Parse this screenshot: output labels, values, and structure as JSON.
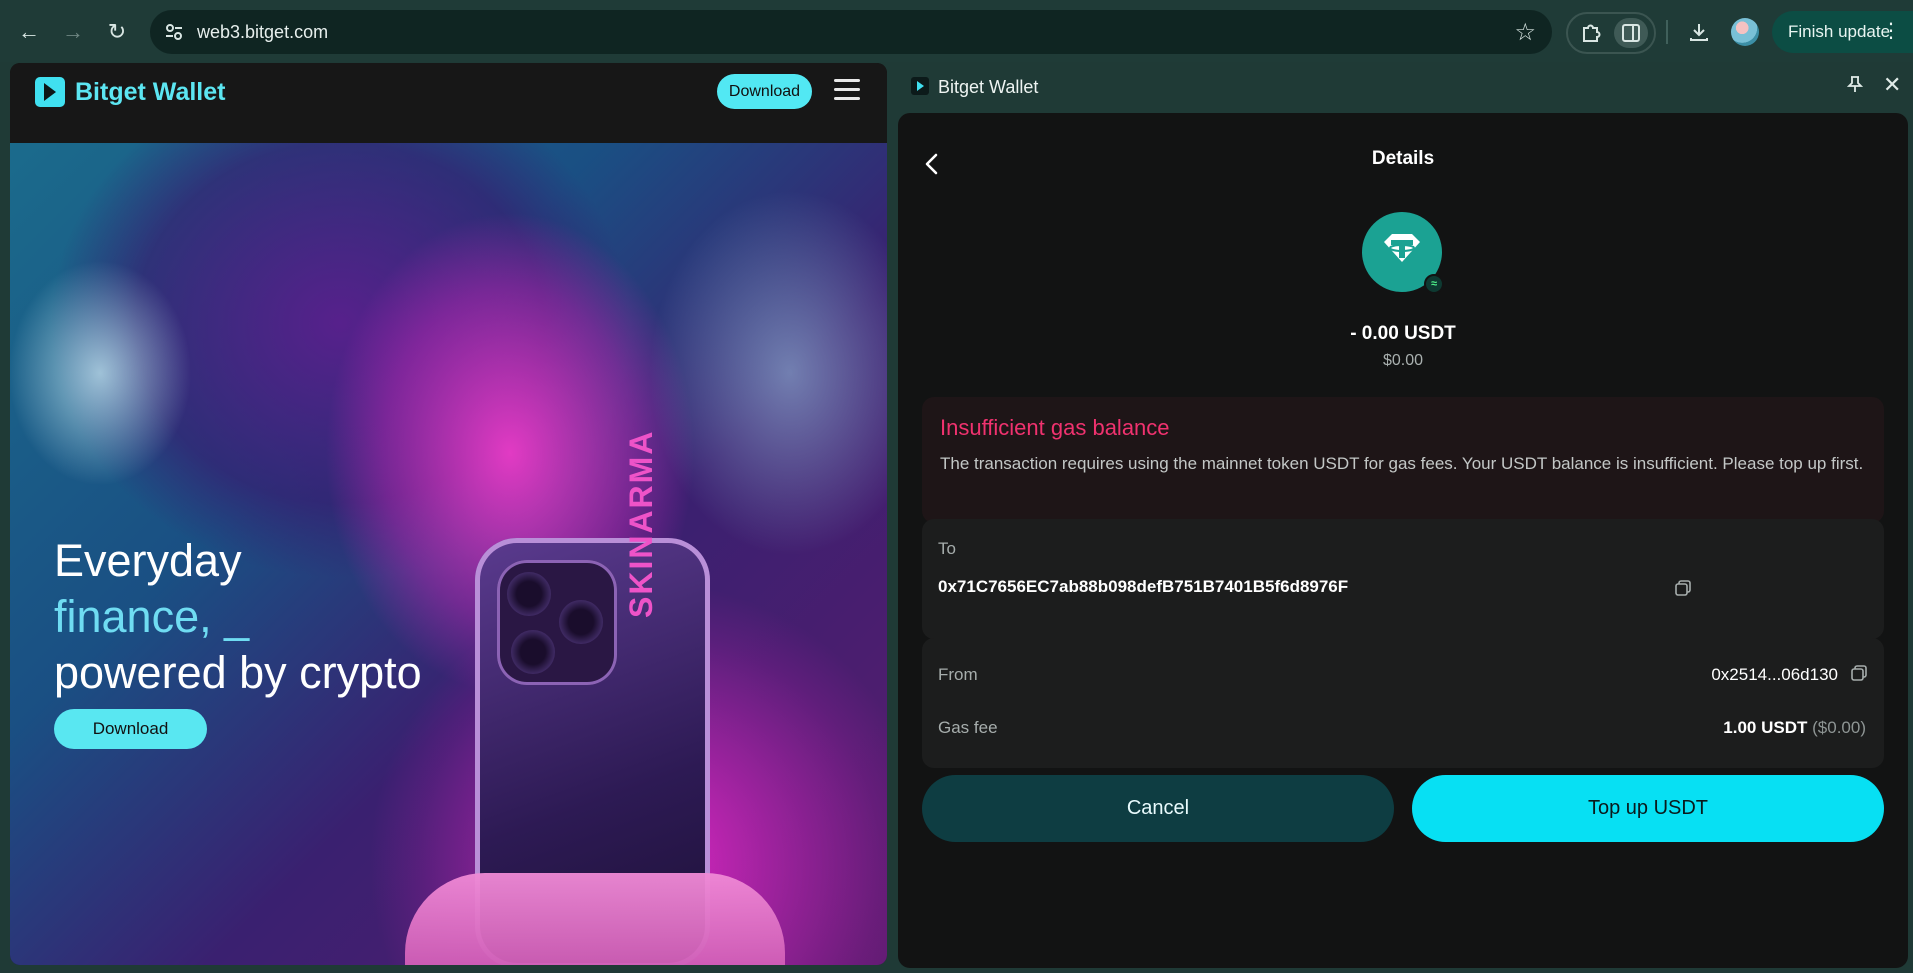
{
  "browser": {
    "url": "web3.bitget.com",
    "finish_update_label": "Finish update"
  },
  "website": {
    "brand": "Bitget Wallet",
    "header_download_label": "Download",
    "hero": {
      "line1": "Everyday",
      "line2": "finance, _",
      "line3": "powered by crypto",
      "download_label": "Download",
      "phone_brand_text": "SKINARMA"
    },
    "accent_color": "#5ce6f2"
  },
  "side_panel": {
    "title": "Bitget Wallet",
    "details": {
      "title": "Details",
      "token_icon": "tether-usdt-icon",
      "amount": "- 0.00 USDT",
      "amount_fiat": "$0.00",
      "warning": {
        "title": "Insufficient gas balance",
        "body": "The transaction requires using the mainnet token USDT for gas fees. Your USDT balance is insufficient. Please top up first."
      },
      "to": {
        "label": "To",
        "address": "0x71C7656EC7ab88b098defB751B7401B5f6d8976F"
      },
      "from": {
        "label": "From",
        "address": "0x2514...06d130"
      },
      "gas_fee": {
        "label": "Gas fee",
        "value": "1.00 USDT",
        "fiat": "($0.00)"
      },
      "cancel_label": "Cancel",
      "topup_label": "Top up USDT"
    },
    "colors": {
      "warning": "#f0326f",
      "primary_button": "#07e0f3",
      "secondary_button": "#0e3d42",
      "token": "#1ba293"
    }
  }
}
